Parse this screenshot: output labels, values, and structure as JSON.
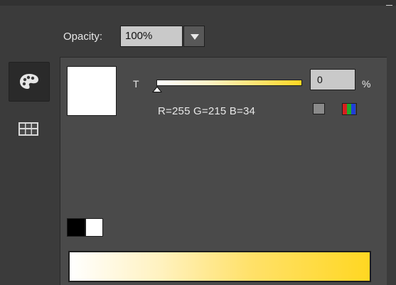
{
  "panel": {
    "menu_icon": "panel-menu-icon"
  },
  "opacity": {
    "label": "Opacity:",
    "value": "100%"
  },
  "sidebar": {
    "items": [
      {
        "icon": "palette-icon",
        "active": true
      },
      {
        "icon": "swatches-grid-icon",
        "active": false
      }
    ]
  },
  "color": {
    "tint_label": "T",
    "tint_value": "0",
    "tint_unit": "%",
    "tint_level_percent": 0,
    "rgb_readout": "R=255 G=215 B=34",
    "base_color": "#ffd722",
    "preview_color": "#ffffff"
  },
  "mode_buttons": {
    "gray_icon": "grayscale-mode-icon",
    "rgb_icon": "rgb-mode-icon"
  }
}
